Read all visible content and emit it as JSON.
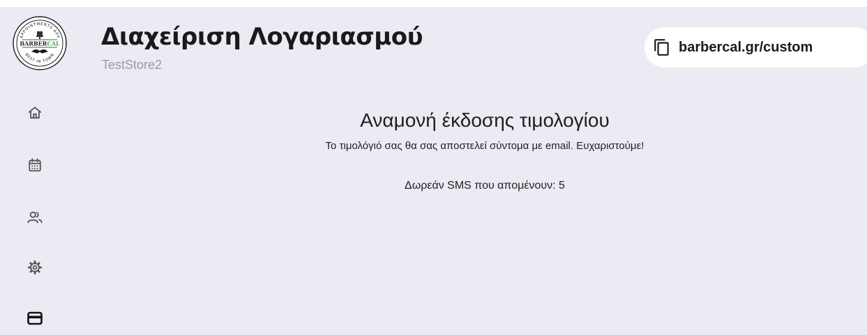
{
  "header": {
    "title": "Διαχείριση Λογαριασμού",
    "store_name": "TestStore2",
    "url_pill": {
      "icon": "copy-icon",
      "text": "barbercal.gr/custom"
    }
  },
  "logo": {
    "top_text": "APPOINTMENTS APP",
    "brand_dark": "BARBER",
    "brand_accent": "CAL",
    "bottom_text": "BEST IN TOWN",
    "accent_color": "#3aa54a"
  },
  "sidebar": {
    "items": [
      {
        "id": "home",
        "icon": "home-icon"
      },
      {
        "id": "calendar",
        "icon": "calendar-icon"
      },
      {
        "id": "customers",
        "icon": "users-icon"
      },
      {
        "id": "settings",
        "icon": "gear-icon"
      },
      {
        "id": "billing",
        "icon": "credit-card-icon",
        "active": true
      }
    ]
  },
  "main": {
    "heading": "Αναμονή έκδοσης τιμολογίου",
    "subtext": "Το τιμολόγιό σας θα σας αποστελεί σύντομα με email. Ευχαριστούμε!",
    "sms_info": "Δωρεάν SMS που απομένουν: 5"
  },
  "colors": {
    "background": "#ebebf4",
    "panel": "#ffffff",
    "text": "#1a1a1a",
    "muted_text": "#9c9c9c"
  }
}
